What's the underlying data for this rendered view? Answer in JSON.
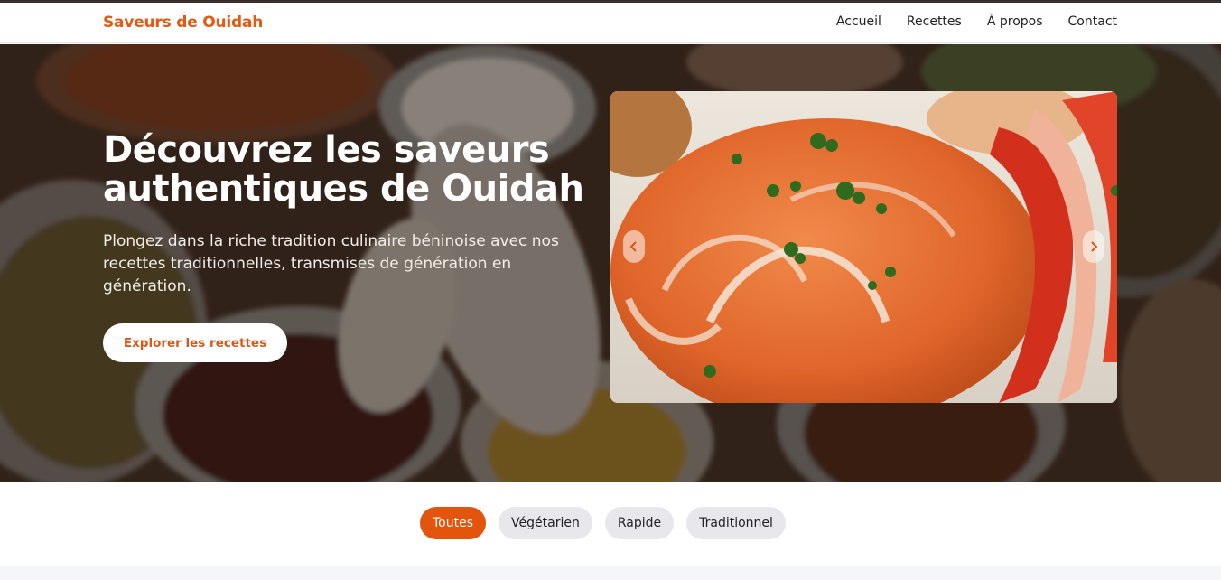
{
  "header": {
    "brand": "Saveurs de Ouidah",
    "nav": [
      {
        "label": "Accueil"
      },
      {
        "label": "Recettes"
      },
      {
        "label": "À propos"
      },
      {
        "label": "Contact"
      }
    ]
  },
  "hero": {
    "title": "Découvrez les saveurs authentiques de Ouidah",
    "subtitle": "Plongez dans la riche tradition culinaire béninoise avec nos recettes traditionnelles, transmises de génération en génération.",
    "cta_label": "Explorer les recettes"
  },
  "carousel": {
    "prev_icon": "chevron-left-icon",
    "next_icon": "chevron-right-icon"
  },
  "filters": [
    {
      "label": "Toutes",
      "active": true
    },
    {
      "label": "Végétarien",
      "active": false
    },
    {
      "label": "Rapide",
      "active": false
    },
    {
      "label": "Traditionnel",
      "active": false
    }
  ],
  "colors": {
    "accent": "#e3540c",
    "brand": "#e35a12"
  }
}
